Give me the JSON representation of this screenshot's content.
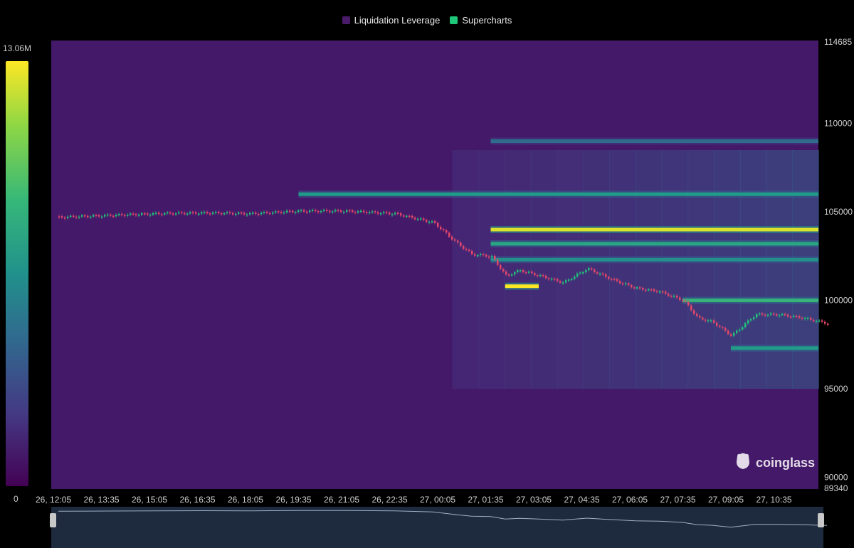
{
  "legend": [
    {
      "label": "Liquidation Leverage",
      "color": "#4a1a6b"
    },
    {
      "label": "Supercharts",
      "color": "#1fc77a"
    }
  ],
  "color_scale": {
    "max_label": "13.06M",
    "min_label": "0"
  },
  "watermark": {
    "text": "coinglass",
    "icon": "coinglass-logo-icon"
  },
  "chart_data": {
    "type": "heatmap",
    "title": "",
    "y_top_label": "114685",
    "y_bottom_label": "89340",
    "ylim": [
      89340,
      114685
    ],
    "y_ticks": [
      90000,
      95000,
      100000,
      105000,
      110000
    ],
    "x_ticks": [
      "26, 12:05",
      "26, 13:35",
      "26, 15:05",
      "26, 16:35",
      "26, 18:05",
      "26, 19:35",
      "26, 21:05",
      "26, 22:35",
      "27, 00:05",
      "27, 01:35",
      "27, 03:05",
      "27, 04:35",
      "27, 06:05",
      "27, 07:35",
      "27, 09:05",
      "27, 10:35"
    ],
    "color_range": [
      0,
      13060000
    ],
    "liquidation_bands": [
      {
        "price": 104000,
        "intensity": 0.95,
        "from_tick": 9
      },
      {
        "price": 103200,
        "intensity": 0.6,
        "from_tick": 9
      },
      {
        "price": 106000,
        "intensity": 0.55,
        "from_tick": 5
      },
      {
        "price": 109000,
        "intensity": 0.35,
        "from_tick": 9
      },
      {
        "price": 100000,
        "intensity": 0.65,
        "from_tick": 13
      },
      {
        "price": 97300,
        "intensity": 0.55,
        "from_tick": 14
      },
      {
        "price": 100800,
        "intensity": 1.0,
        "from_tick": 9.3,
        "to_tick": 10
      },
      {
        "price": 102300,
        "intensity": 0.5,
        "from_tick": 9
      }
    ],
    "price_series": {
      "name": "Supercharts",
      "x_tick_index": [
        0,
        1,
        2,
        3,
        4,
        5,
        6,
        7,
        7.8,
        8.3,
        8.6,
        9,
        9.3,
        9.6,
        10,
        10.5,
        11,
        11.5,
        12,
        12.5,
        13,
        13.3,
        13.6,
        14,
        14.5,
        15,
        15.5,
        16
      ],
      "values": [
        104700,
        104800,
        104900,
        104950,
        104900,
        105050,
        105050,
        104900,
        104400,
        103200,
        102600,
        102500,
        101400,
        101700,
        101400,
        101000,
        101800,
        101200,
        100700,
        100500,
        100000,
        99000,
        98800,
        98000,
        99200,
        99200,
        99000,
        98700
      ]
    }
  }
}
